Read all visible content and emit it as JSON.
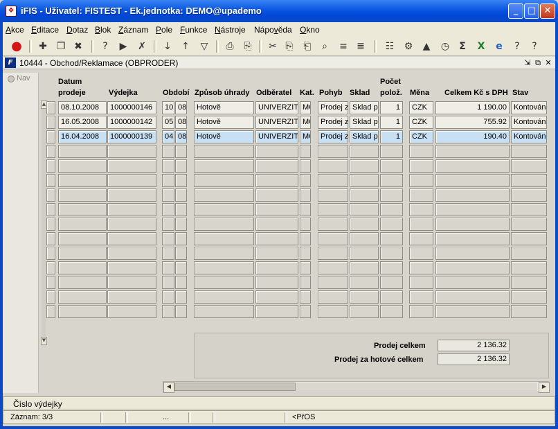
{
  "window": {
    "title": "iFIS - Uživatel: FISTEST - Ek.jednotka: DEMO@upademo"
  },
  "menu": [
    {
      "pre": "",
      "ul": "A",
      "post": "kce"
    },
    {
      "pre": "",
      "ul": "E",
      "post": "ditace"
    },
    {
      "pre": "",
      "ul": "D",
      "post": "otaz"
    },
    {
      "pre": "",
      "ul": "B",
      "post": "lok"
    },
    {
      "pre": "",
      "ul": "Z",
      "post": "áznam"
    },
    {
      "pre": "",
      "ul": "P",
      "post": "ole"
    },
    {
      "pre": "",
      "ul": "F",
      "post": "unkce"
    },
    {
      "pre": "",
      "ul": "N",
      "post": "ástroje"
    },
    {
      "pre": "Nápo",
      "ul": "v",
      "post": "ěda"
    },
    {
      "pre": "",
      "ul": "O",
      "post": "kno"
    }
  ],
  "toolbar_icons": [
    "exit-icon",
    "insert-record-icon",
    "duplicate-record-icon",
    "delete-record-icon",
    "query-enter-icon",
    "query-execute-icon",
    "query-cancel-icon",
    "sort-asc-icon",
    "sort-desc-icon",
    "filter-icon",
    "print-icon",
    "print-preview-icon",
    "cut-icon",
    "copy-icon",
    "paste-icon",
    "search-icon",
    "expand-icon",
    "collapse-icon",
    "calculator-icon",
    "settings-icon",
    "chart-icon",
    "clock-icon",
    "sum-icon",
    "excel-icon",
    "internet-icon",
    "help-about-icon",
    "help-icon"
  ],
  "form": {
    "title": "10444 - Obchod/Reklamace (OBPRODER)",
    "nav_label": "Nav",
    "headers": {
      "datum_line1": "Datum",
      "datum_line2": "prodeje",
      "vydejka": "Výdejka",
      "obdobi": "Období",
      "zpusob": "Způsob úhrady",
      "odberatel": "Odběratel",
      "kat": "Kat.",
      "pohyb": "Pohyb",
      "sklad": "Sklad",
      "pocet_line1": "Počet",
      "pocet_line2": "polož.",
      "mena": "Měna",
      "celkem": "Celkem Kč s DPH",
      "stav": "Stav"
    },
    "rows": [
      {
        "datum": "08.10.2008",
        "vydejka": "1000000146",
        "obd1": "10",
        "obd2": "08",
        "zpusob": "Hotově",
        "odberatel": "UNIVERZITA",
        "kat": "MO",
        "pohyb": "Prodej z",
        "sklad": "Sklad pr",
        "pocet": "1",
        "mena": "CZK",
        "celkem": "1 190.00",
        "stav": "Kontován"
      },
      {
        "datum": "16.05.2008",
        "vydejka": "1000000142",
        "obd1": "05",
        "obd2": "08",
        "zpusob": "Hotově",
        "odberatel": "UNIVERZITA",
        "kat": "MO",
        "pohyb": "Prodej z",
        "sklad": "Sklad pr",
        "pocet": "1",
        "mena": "CZK",
        "celkem": "755.92",
        "stav": "Kontován"
      },
      {
        "datum": "16.04.2008",
        "vydejka": "1000000139",
        "obd1": "04",
        "obd2": "08",
        "zpusob": "Hotově",
        "odberatel": "UNIVERZITA",
        "kat": "MO",
        "pohyb": "Prodej z",
        "sklad": "Sklad pr",
        "pocet": "1",
        "mena": "CZK",
        "celkem": "190.40",
        "stav": "Kontován"
      }
    ],
    "totals": {
      "prodej_celkem_label": "Prodej celkem",
      "prodej_celkem_value": "2 136.32",
      "hotove_label": "Prodej za hotové celkem",
      "hotove_value": "2 136.32"
    }
  },
  "hint": "Číslo výdejky",
  "status": {
    "record": "Záznam: 3/3",
    "ellipsis": "...",
    "mode": "<PřOS"
  }
}
